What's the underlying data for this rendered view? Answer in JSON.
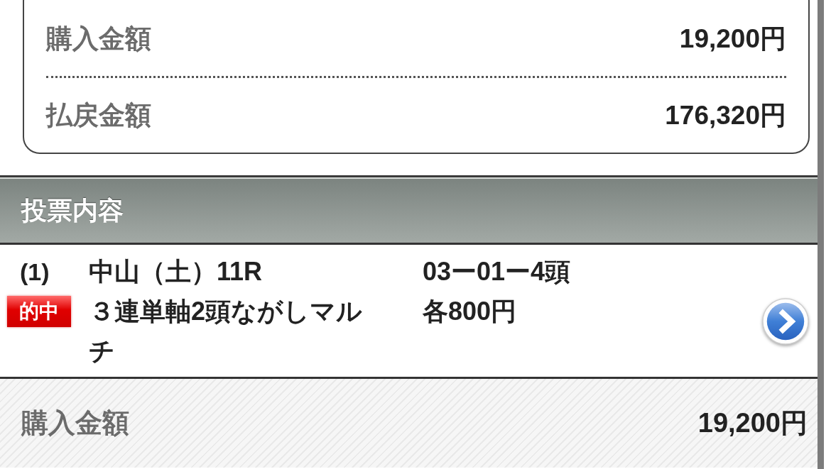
{
  "summary": {
    "rows": [
      {
        "label": "購入金額",
        "value": "19,200円"
      },
      {
        "label": "払戻金額",
        "value": "176,320円"
      }
    ]
  },
  "section": {
    "title": "投票内容"
  },
  "bets": [
    {
      "number": "(1)",
      "badge": "的中",
      "venue": "中山（土）11R",
      "bet_type": "３連単軸2頭ながしマルチ",
      "combination": "03ー01ー4頭",
      "amount": "各800円"
    }
  ],
  "total": {
    "label": "購入金額",
    "value": "19,200円"
  }
}
